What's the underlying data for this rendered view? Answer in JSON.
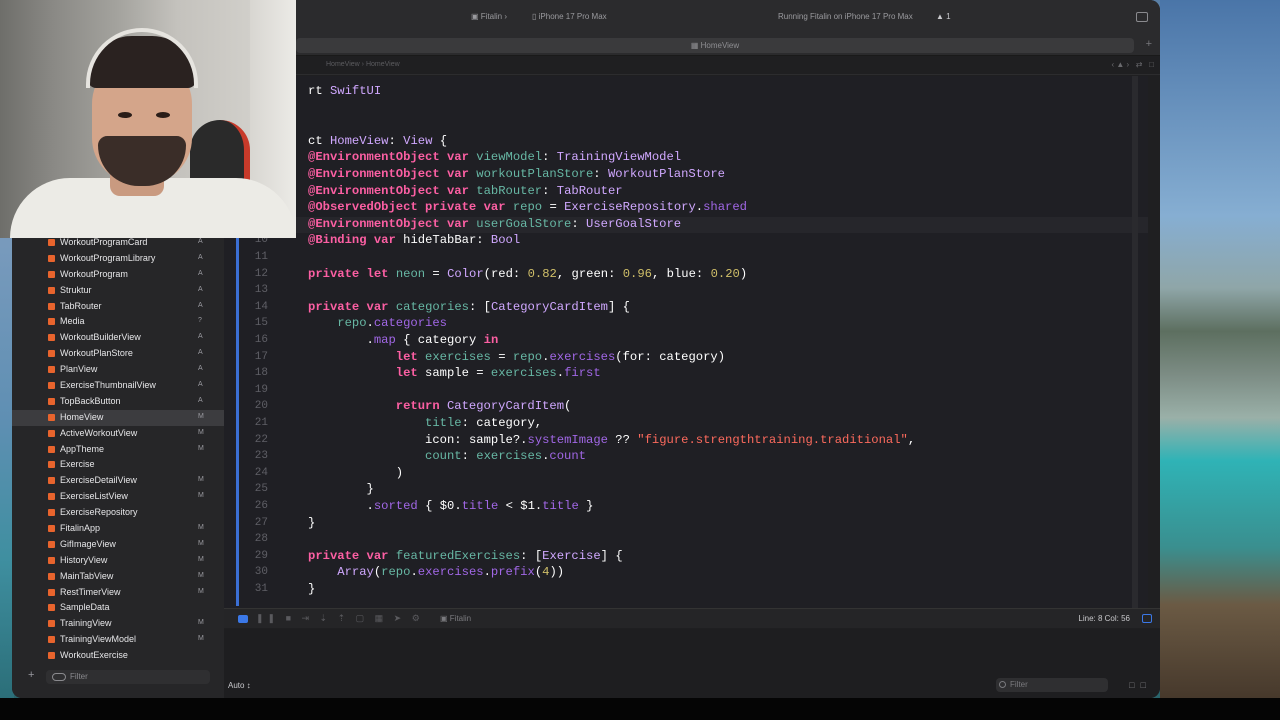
{
  "toolbar": {
    "scheme": "Fitalin",
    "device": "iPhone 17 Pro Max",
    "status": "Running Fitalin on iPhone 17 Pro Max",
    "warnings": "1"
  },
  "tab": {
    "title": "HomeView"
  },
  "jumpbar": {
    "crumb_1": "HomeView",
    "crumb_2": "HomeView"
  },
  "navigator": {
    "items": [
      {
        "label": "WorkoutProgramCard",
        "badge": "A"
      },
      {
        "label": "WorkoutProgramLibrary",
        "badge": "A"
      },
      {
        "label": "WorkoutProgram",
        "badge": "A"
      },
      {
        "label": "Struktur",
        "badge": "A"
      },
      {
        "label": "TabRouter",
        "badge": "A"
      },
      {
        "label": "Media",
        "badge": "?"
      },
      {
        "label": "WorkoutBuilderView",
        "badge": "A"
      },
      {
        "label": "WorkoutPlanStore",
        "badge": "A"
      },
      {
        "label": "PlanView",
        "badge": "A"
      },
      {
        "label": "ExerciseThumbnailView",
        "badge": "A"
      },
      {
        "label": "TopBackButton",
        "badge": "A"
      },
      {
        "label": "HomeView",
        "badge": "M"
      },
      {
        "label": "ActiveWorkoutView",
        "badge": "M"
      },
      {
        "label": "AppTheme",
        "badge": "M"
      },
      {
        "label": "Exercise",
        "badge": ""
      },
      {
        "label": "ExerciseDetailView",
        "badge": "M"
      },
      {
        "label": "ExerciseListView",
        "badge": "M"
      },
      {
        "label": "ExerciseRepository",
        "badge": ""
      },
      {
        "label": "FitalinApp",
        "badge": "M"
      },
      {
        "label": "GifImageView",
        "badge": "M"
      },
      {
        "label": "HistoryView",
        "badge": "M"
      },
      {
        "label": "MainTabView",
        "badge": "M"
      },
      {
        "label": "RestTimerView",
        "badge": "M"
      },
      {
        "label": "SampleData",
        "badge": ""
      },
      {
        "label": "TrainingView",
        "badge": "M"
      },
      {
        "label": "TrainingViewModel",
        "badge": "M"
      },
      {
        "label": "WorkoutExercise",
        "badge": ""
      }
    ],
    "filter_placeholder": "Filter"
  },
  "editor": {
    "line_numbers": [
      "10",
      "11",
      "12",
      "13",
      "14",
      "15",
      "16",
      "17",
      "18",
      "19",
      "20",
      "21",
      "22",
      "23",
      "24",
      "25",
      "26",
      "27",
      "28",
      "29",
      "30",
      "31"
    ],
    "header_lines": [
      "rt SwiftUI",
      "",
      "ct HomeView: View {",
      "@EnvironmentObject var viewModel: TrainingViewModel",
      "@EnvironmentObject var workoutPlanStore: WorkoutPlanStore",
      "@EnvironmentObject var tabRouter: TabRouter",
      "@ObservedObject private var repo = ExerciseRepository.shared",
      "@EnvironmentObject var userGoalStore: UserGoalStore"
    ],
    "code_lines": [
      "@Binding var hideTabBar: Bool",
      "",
      "private let neon = Color(red: 0.82, green: 0.96, blue: 0.20)",
      "",
      "private var categories: [CategoryCardItem] {",
      "    repo.categories",
      "        .map { category in",
      "            let exercises = repo.exercises(for: category)",
      "            let sample = exercises.first",
      "",
      "            return CategoryCardItem(",
      "                title: category,",
      "                icon: sample?.systemImage ?? \"figure.strengthtraining.traditional\",",
      "                count: exercises.count",
      "            )",
      "        }",
      "        .sorted { $0.title < $1.title }",
      "}",
      "",
      "private var featuredExercises: [Exercise] {",
      "    Array(repo.exercises.prefix(4))",
      "}"
    ]
  },
  "debugbar": {
    "target": "Fitalin",
    "position": "Line: 8  Col: 56"
  },
  "console": {
    "mode": "Auto ↕",
    "filter_placeholder": "Filter"
  }
}
